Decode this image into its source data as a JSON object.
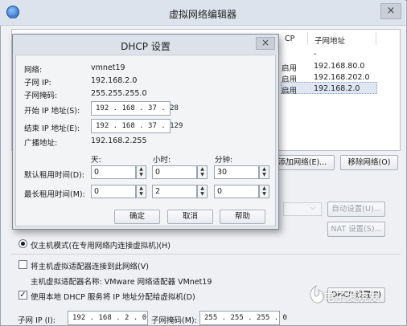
{
  "outer": {
    "title": "虚拟网络编辑器",
    "close": "×",
    "table_headers": [
      "CP",
      "子网地址"
    ],
    "rows": [
      {
        "dhcp": "",
        "subnet": "-"
      },
      {
        "dhcp": "启用",
        "subnet": "192.168.80.0"
      },
      {
        "dhcp": "启用",
        "subnet": "192.168.202.0"
      },
      {
        "dhcp": "启用",
        "subnet": "192.168.2.0"
      }
    ],
    "add_network": "添加网络(E)...",
    "remove_network": "移除网络(O)",
    "auto_settings": "自动设置(U)...",
    "nat_settings": "NAT 设置(S)...",
    "host_only_label": "仅主机模式(在专用网络内连接虚拟机)(H)",
    "connect_adapter_label": "将主机虚拟适配器连接到此网络(V)",
    "adapter_name_label": "主机虚拟适配器名称: VMware 网络适配器 VMnet19",
    "use_dhcp_label": "使用本地 DHCP 服务将 IP 地址分配给虚拟机(D)",
    "dhcp_settings_btn": "DHCP 设置(P)",
    "subnet_ip_label": "子网 IP (I):",
    "subnet_ip_value": "192 . 168 . 2 . 0",
    "subnet_mask_label": "子网掩码(M):",
    "subnet_mask_value": "255 . 255 . 255 . 0"
  },
  "dialog": {
    "title": "DHCP 设置",
    "close": "×",
    "network_label": "网络:",
    "network_value": "vmnet19",
    "subnet_ip_label": "子网 IP:",
    "subnet_ip_value": "192.168.2.0",
    "subnet_mask_label": "子网掩码:",
    "subnet_mask_value": "255.255.255.0",
    "start_ip_label": "开始 IP 地址(S):",
    "start_ip_value": "192 . 168 . 37 . 28",
    "end_ip_label": "结束 IP 地址(E):",
    "end_ip_value": "192 . 168 . 37 . 129",
    "broadcast_label": "广播地址:",
    "broadcast_value": "192.168.2.255",
    "days_label": "天:",
    "hours_label": "小时:",
    "minutes_label": "分钟:",
    "default_lease_label": "默认租用时间(D):",
    "default_lease": {
      "days": "0",
      "hours": "0",
      "minutes": "30"
    },
    "max_lease_label": "最长租用时间(M):",
    "max_lease": {
      "days": "0",
      "hours": "2",
      "minutes": "0"
    },
    "ok": "确定",
    "cancel": "取消",
    "help": "帮助"
  },
  "watermark": {
    "text": "电子发烧友"
  },
  "colors": {
    "accent": "#dde3ec",
    "dialog_bg": "#f2f4f6",
    "selection": "#dfe7f3"
  }
}
